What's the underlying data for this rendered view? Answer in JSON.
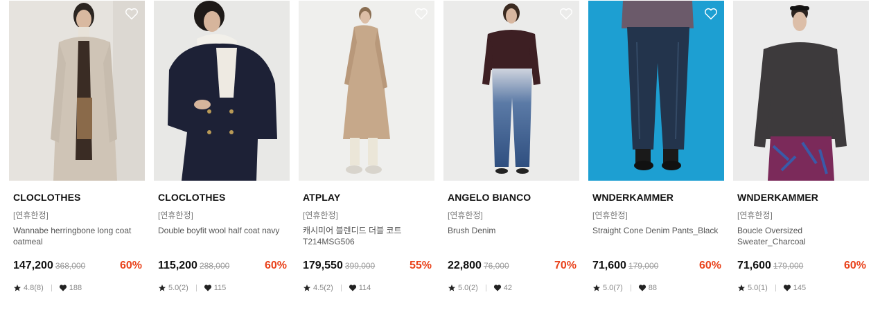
{
  "products": [
    {
      "brand": "CLOCLOTHES",
      "tag": "[연휴한정]",
      "name": "Wannabe herringbone long coat oatmeal",
      "price": "147,200",
      "original_price": "368,000",
      "discount": "60%",
      "rating": "4.8(8)",
      "likes": "188",
      "image": "woman in oatmeal herringbone long coat",
      "photo_bg": "#e6e3de"
    },
    {
      "brand": "CLOCLOTHES",
      "tag": "[연휴한정]",
      "name": "Double boyfit wool half coat navy",
      "price": "115,200",
      "original_price": "288,000",
      "discount": "60%",
      "rating": "5.0(2)",
      "likes": "115",
      "image": "model in navy double-breasted half coat",
      "photo_bg": "#e8e8e6"
    },
    {
      "brand": "ATPLAY",
      "tag": "[연휴한정]",
      "name": "캐시미어 블렌디드 더블 코트 T214MSG506",
      "price": "179,550",
      "original_price": "399,000",
      "discount": "55%",
      "rating": "4.5(2)",
      "likes": "114",
      "image": "woman in camel double coat",
      "photo_bg": "#efefed"
    },
    {
      "brand": "ANGELO BIANCO",
      "tag": "[연휴한정]",
      "name": "Brush Denim",
      "price": "22,800",
      "original_price": "76,000",
      "discount": "70%",
      "rating": "5.0(2)",
      "likes": "42",
      "image": "woman in gradient brush denim jeans",
      "photo_bg": "#ebebea"
    },
    {
      "brand": "WNDERKAMMER",
      "tag": "[연휴한정]",
      "name": "Straight Cone Denim Pants_Black",
      "price": "71,600",
      "original_price": "179,000",
      "discount": "60%",
      "rating": "5.0(7)",
      "likes": "88",
      "image": "black straight cone denim pants on blue background",
      "photo_bg": "#1d9fd2"
    },
    {
      "brand": "WNDERKAMMER",
      "tag": "[연휴한정]",
      "name": "Boucle Oversized Sweater_Charcoal",
      "price": "71,600",
      "original_price": "179,000",
      "discount": "60%",
      "rating": "5.0(1)",
      "likes": "145",
      "image": "woman in charcoal boucle oversized sweater",
      "photo_bg": "#ebebeb"
    }
  ],
  "icons": {
    "wishlist": "heart-outline-icon",
    "rating": "star-icon",
    "likes": "heart-filled-icon"
  },
  "colors": {
    "discount": "#e9421b",
    "brand_text": "#111111",
    "muted_text": "#888888"
  }
}
